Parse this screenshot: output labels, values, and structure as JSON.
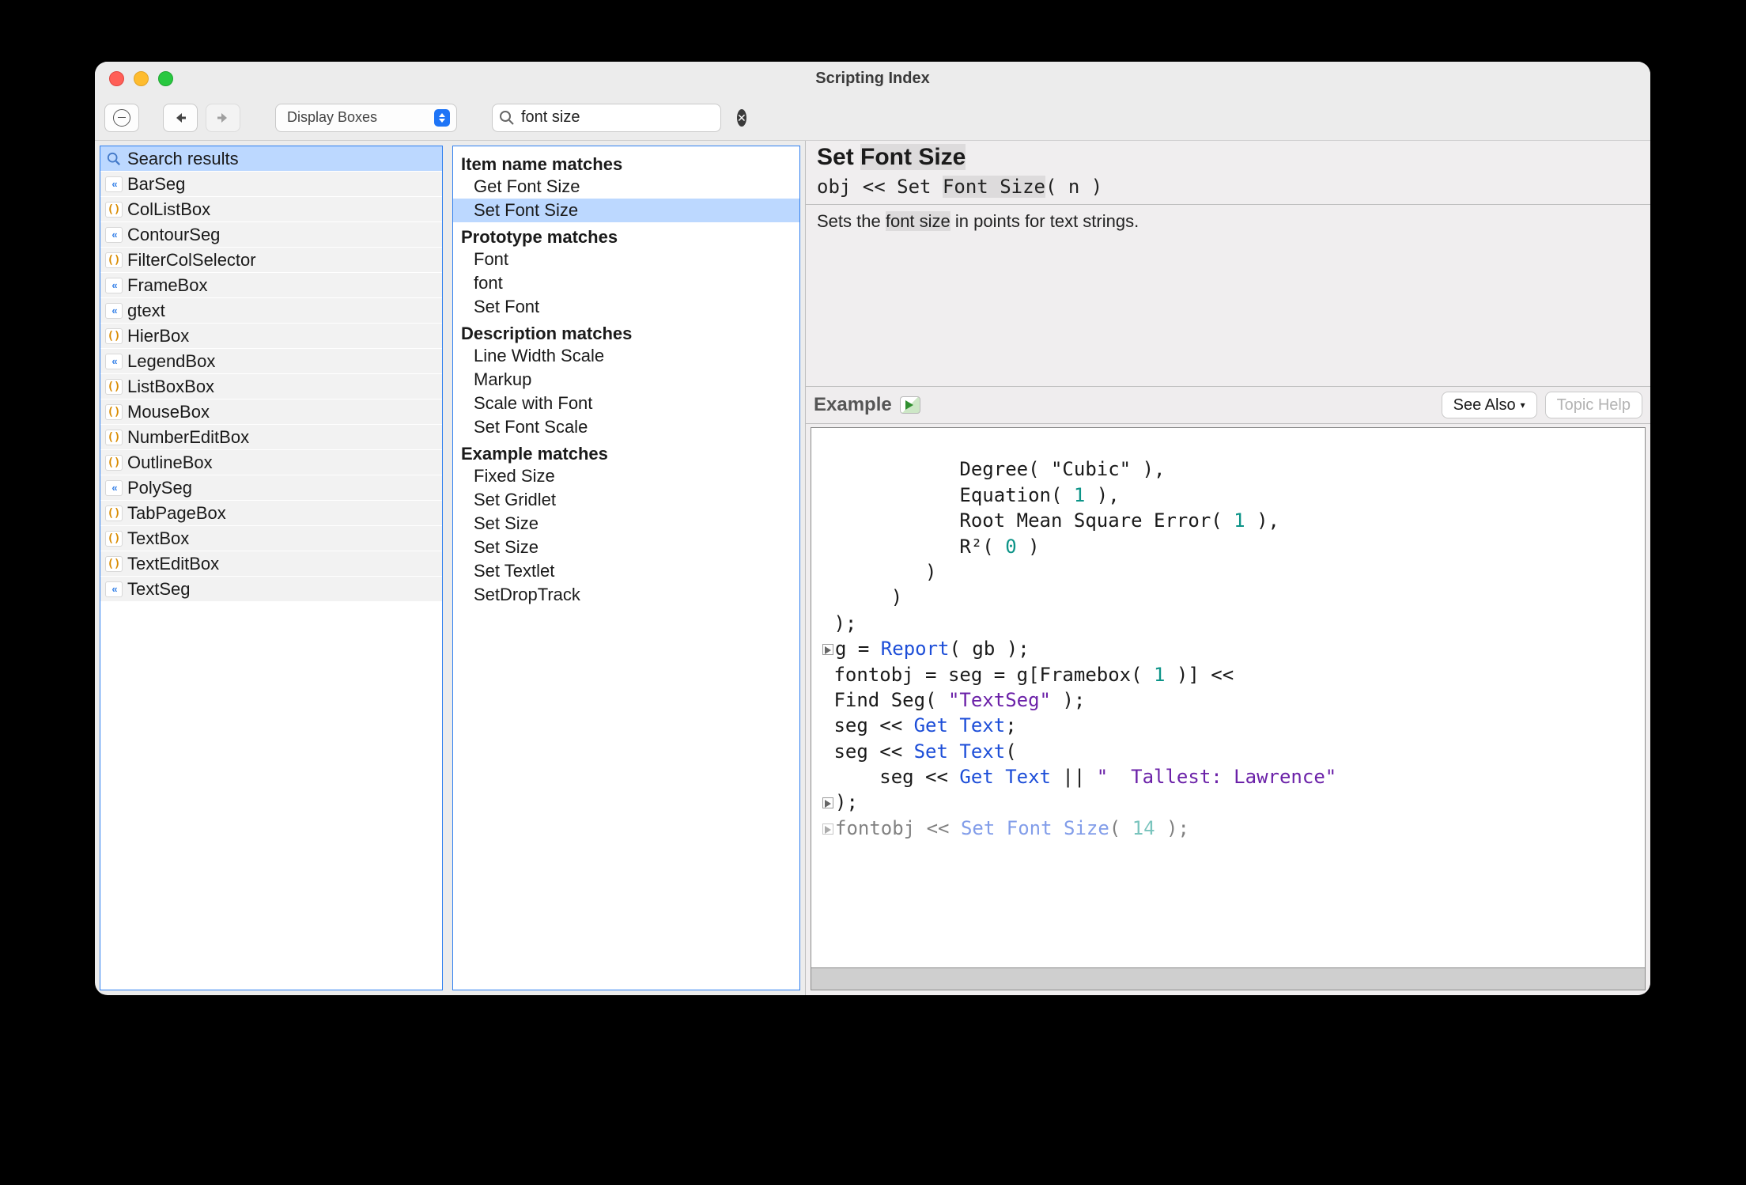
{
  "window": {
    "title": "Scripting Index"
  },
  "toolbar": {
    "category": "Display Boxes",
    "search_value": "font size"
  },
  "sidebar": {
    "header": {
      "label": "Search results",
      "icon": "magnifier-icon"
    },
    "items": [
      {
        "icon": "dbl",
        "label": "BarSeg"
      },
      {
        "icon": "par",
        "label": "ColListBox"
      },
      {
        "icon": "dbl",
        "label": "ContourSeg"
      },
      {
        "icon": "par",
        "label": "FilterColSelector"
      },
      {
        "icon": "dbl",
        "label": "FrameBox"
      },
      {
        "icon": "dbl",
        "label": "gtext"
      },
      {
        "icon": "par",
        "label": "HierBox"
      },
      {
        "icon": "dbl",
        "label": "LegendBox"
      },
      {
        "icon": "par",
        "label": "ListBoxBox"
      },
      {
        "icon": "par",
        "label": "MouseBox"
      },
      {
        "icon": "par",
        "label": "NumberEditBox"
      },
      {
        "icon": "par",
        "label": "OutlineBox"
      },
      {
        "icon": "dbl",
        "label": "PolySeg"
      },
      {
        "icon": "par",
        "label": "TabPageBox"
      },
      {
        "icon": "par",
        "label": "TextBox"
      },
      {
        "icon": "par",
        "label": "TextEditBox"
      },
      {
        "icon": "dbl",
        "label": "TextSeg"
      }
    ]
  },
  "results": {
    "sections": [
      {
        "header": "Item name matches",
        "items": [
          {
            "label": "Get Font Size",
            "selected": false
          },
          {
            "label": "Set Font Size",
            "selected": true
          }
        ]
      },
      {
        "header": "Prototype matches",
        "items": [
          {
            "label": "Font"
          },
          {
            "label": "font"
          },
          {
            "label": "Set Font"
          }
        ]
      },
      {
        "header": "Description matches",
        "items": [
          {
            "label": "Line Width Scale"
          },
          {
            "label": "Markup"
          },
          {
            "label": "Scale with Font"
          },
          {
            "label": "Set Font Scale"
          }
        ]
      },
      {
        "header": "Example matches",
        "items": [
          {
            "label": "Fixed Size"
          },
          {
            "label": "Set Gridlet"
          },
          {
            "label": "Set Size"
          },
          {
            "label": "Set Size"
          },
          {
            "label": "Set Textlet"
          },
          {
            "label": "SetDropTrack"
          }
        ]
      }
    ]
  },
  "detail": {
    "title_pre": "Set ",
    "title_hl": "Font Size",
    "signature_pre": "obj << Set ",
    "signature_hl": "Font Size",
    "signature_post": "( n )",
    "description_pre": "Sets the ",
    "description_hl": "font size",
    "description_post": " in points for text strings.",
    "example_label": "Example",
    "see_also": "See Also",
    "topic_help": "Topic Help",
    "code": {
      "l1": "            Degree( \"Cubic\" ),",
      "l2": "            Equation( 1 ),",
      "l3": "            Root Mean Square Error( 1 ),",
      "l4": "            R²( 0 )",
      "l5": "         )",
      "l6": "      )",
      "l7": " );",
      "l8a": "g = ",
      "l8b": "Report",
      "l8c": "( gb );",
      "l9a": " fontobj = seg = g[Framebox( ",
      "l9b": "1",
      "l9c": " )] <<",
      "l10a": " Find Seg( ",
      "l10b": "\"TextSeg\"",
      "l10c": " );",
      "l11a": " seg << ",
      "l11b": "Get Text",
      "l11c": ";",
      "l12a": " seg << ",
      "l12b": "Set Text",
      "l12c": "(",
      "l13a": "     seg << ",
      "l13b": "Get Text",
      "l13c": " || ",
      "l13d": "\"  Tallest: Lawrence\"",
      "l14": ");",
      "l15a": "fontobj << ",
      "l15b": "Set Font Size",
      "l15c": "( ",
      "l15d": "14",
      "l15e": " );"
    }
  }
}
